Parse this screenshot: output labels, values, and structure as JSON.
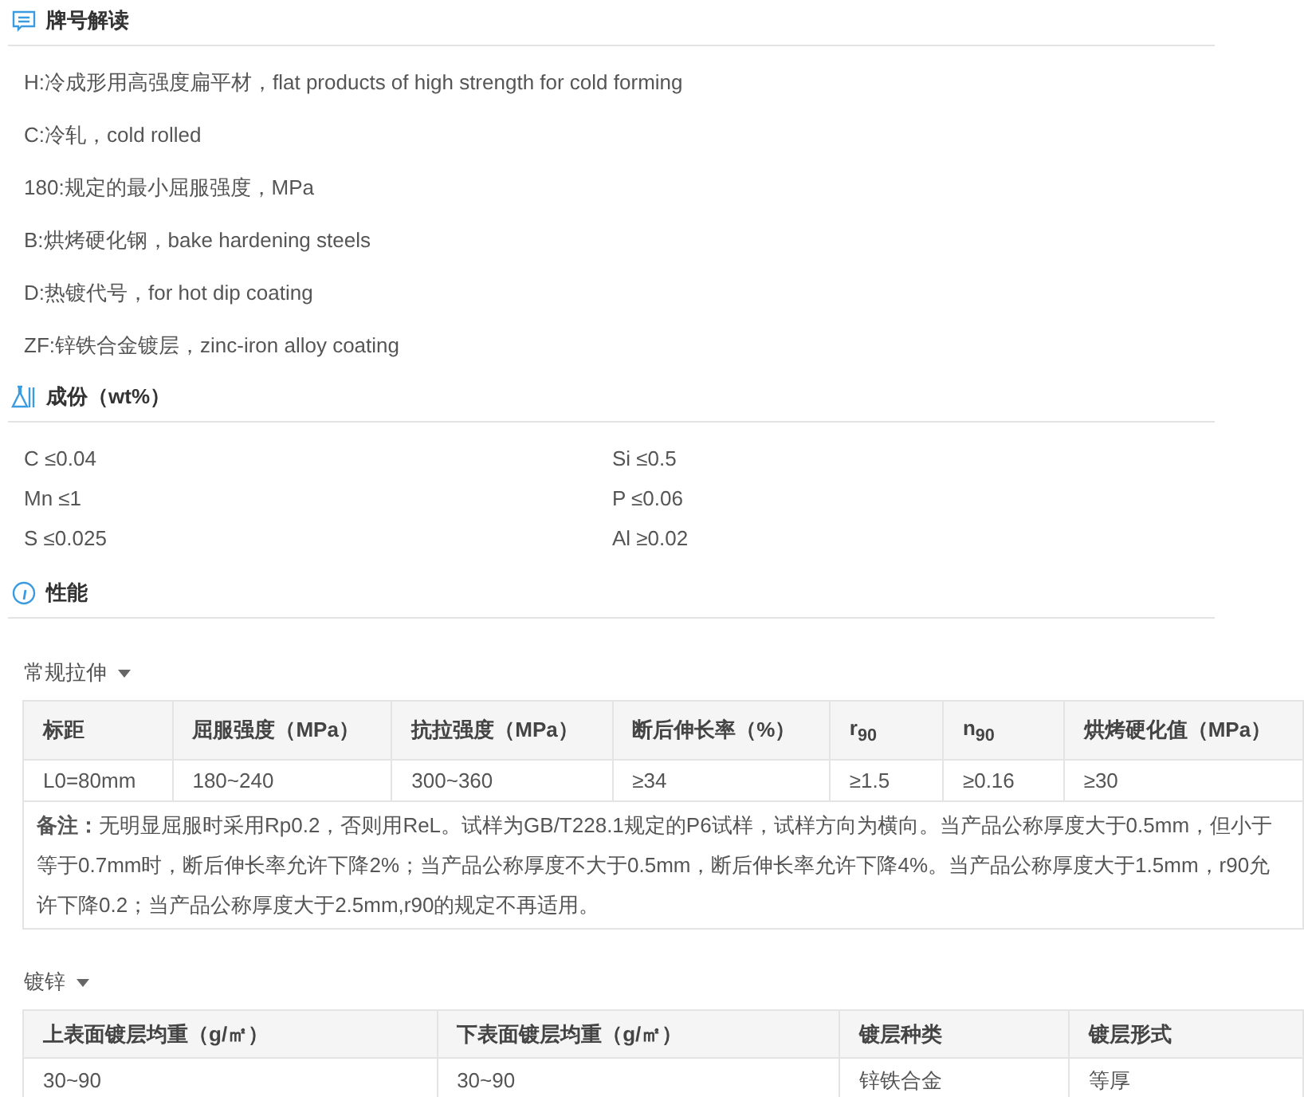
{
  "sections": [
    {
      "kind": "designation",
      "title": "牌号解读",
      "items": [
        "H:冷成形用高强度扁平材，flat products of high strength for cold forming",
        "C:冷轧，cold rolled",
        "180:规定的最小屈服强度，MPa",
        "B:烘烤硬化钢，bake hardening steels",
        "D:热镀代号，for hot dip coating",
        "ZF:锌铁合金镀层，zinc-iron alloy coating"
      ]
    },
    {
      "kind": "composition",
      "title": "成份（wt%）",
      "items": [
        "C ≤0.04",
        "Si ≤0.5",
        "Mn ≤1",
        "P ≤0.06",
        "S ≤0.025",
        "Al ≥0.02"
      ]
    },
    {
      "kind": "properties",
      "title": "性能",
      "groups": [
        {
          "label": "常规拉伸",
          "columns": [
            "标距",
            "屈服强度（MPa）",
            "抗拉强度（MPa）",
            "断后伸长率（%）",
            "r$_{90}$",
            "n$_{90}$",
            "烘烤硬化值（MPa）"
          ],
          "rows": [
            [
              "L0=80mm",
              "180~240",
              "300~360",
              "≥34",
              "≥1.5",
              "≥0.16",
              "≥30"
            ]
          ],
          "note": "**备注：**无明显屈服时采用Rp0.2，否则用ReL。试样为GB/T228.1规定的P6试样，试样方向为横向。当产品公称厚度大于0.5mm，但小于等于0.7mm时，断后伸长率允许下降2%；当产品公称厚度不大于0.5mm，断后伸长率允许下降4%。当产品公称厚度大于1.5mm，r90允许下降0.2；当产品公称厚度大于2.5mm,r90的规定不再适用。"
        },
        {
          "label": "镀锌",
          "columns": [
            "上表面镀层均重（g/㎡）",
            "下表面镀层均重（g/㎡）",
            "镀层种类",
            "镀层形式"
          ],
          "rows": [
            [
              "30~90",
              "30~90",
              "锌铁合金",
              "等厚"
            ]
          ]
        }
      ]
    }
  ]
}
